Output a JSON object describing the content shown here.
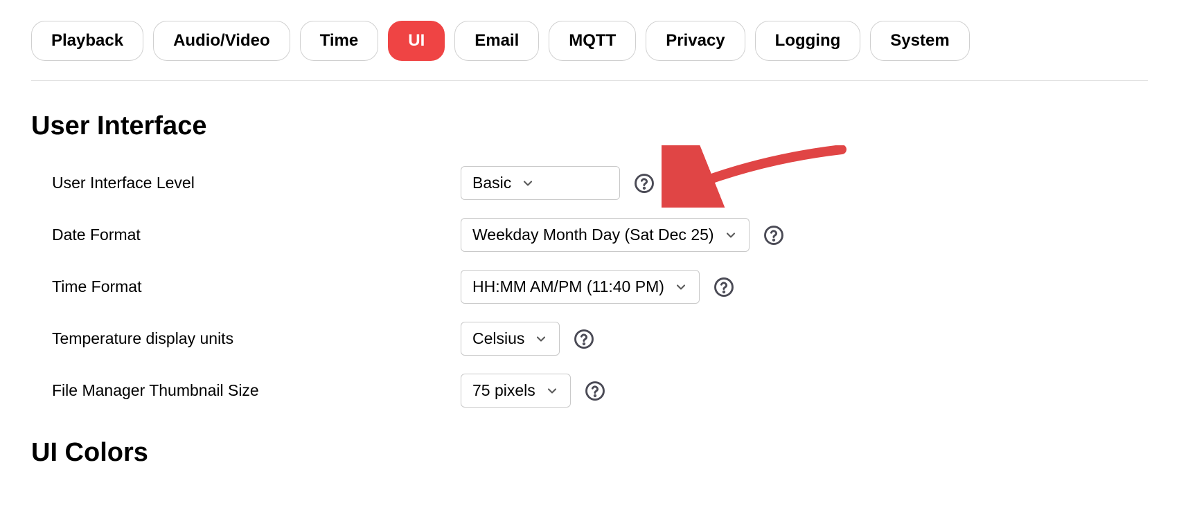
{
  "tabs": [
    {
      "label": "Playback",
      "active": false
    },
    {
      "label": "Audio/Video",
      "active": false
    },
    {
      "label": "Time",
      "active": false
    },
    {
      "label": "UI",
      "active": true
    },
    {
      "label": "Email",
      "active": false
    },
    {
      "label": "MQTT",
      "active": false
    },
    {
      "label": "Privacy",
      "active": false
    },
    {
      "label": "Logging",
      "active": false
    },
    {
      "label": "System",
      "active": false
    }
  ],
  "section1": {
    "heading": "User Interface",
    "fields": [
      {
        "label": "User Interface Level",
        "value": "Basic"
      },
      {
        "label": "Date Format",
        "value": "Weekday Month Day (Sat Dec 25)"
      },
      {
        "label": "Time Format",
        "value": "HH:MM AM/PM (11:40 PM)"
      },
      {
        "label": "Temperature display units",
        "value": "Celsius"
      },
      {
        "label": "File Manager Thumbnail Size",
        "value": "75 pixels"
      }
    ]
  },
  "section2": {
    "heading": "UI Colors"
  }
}
